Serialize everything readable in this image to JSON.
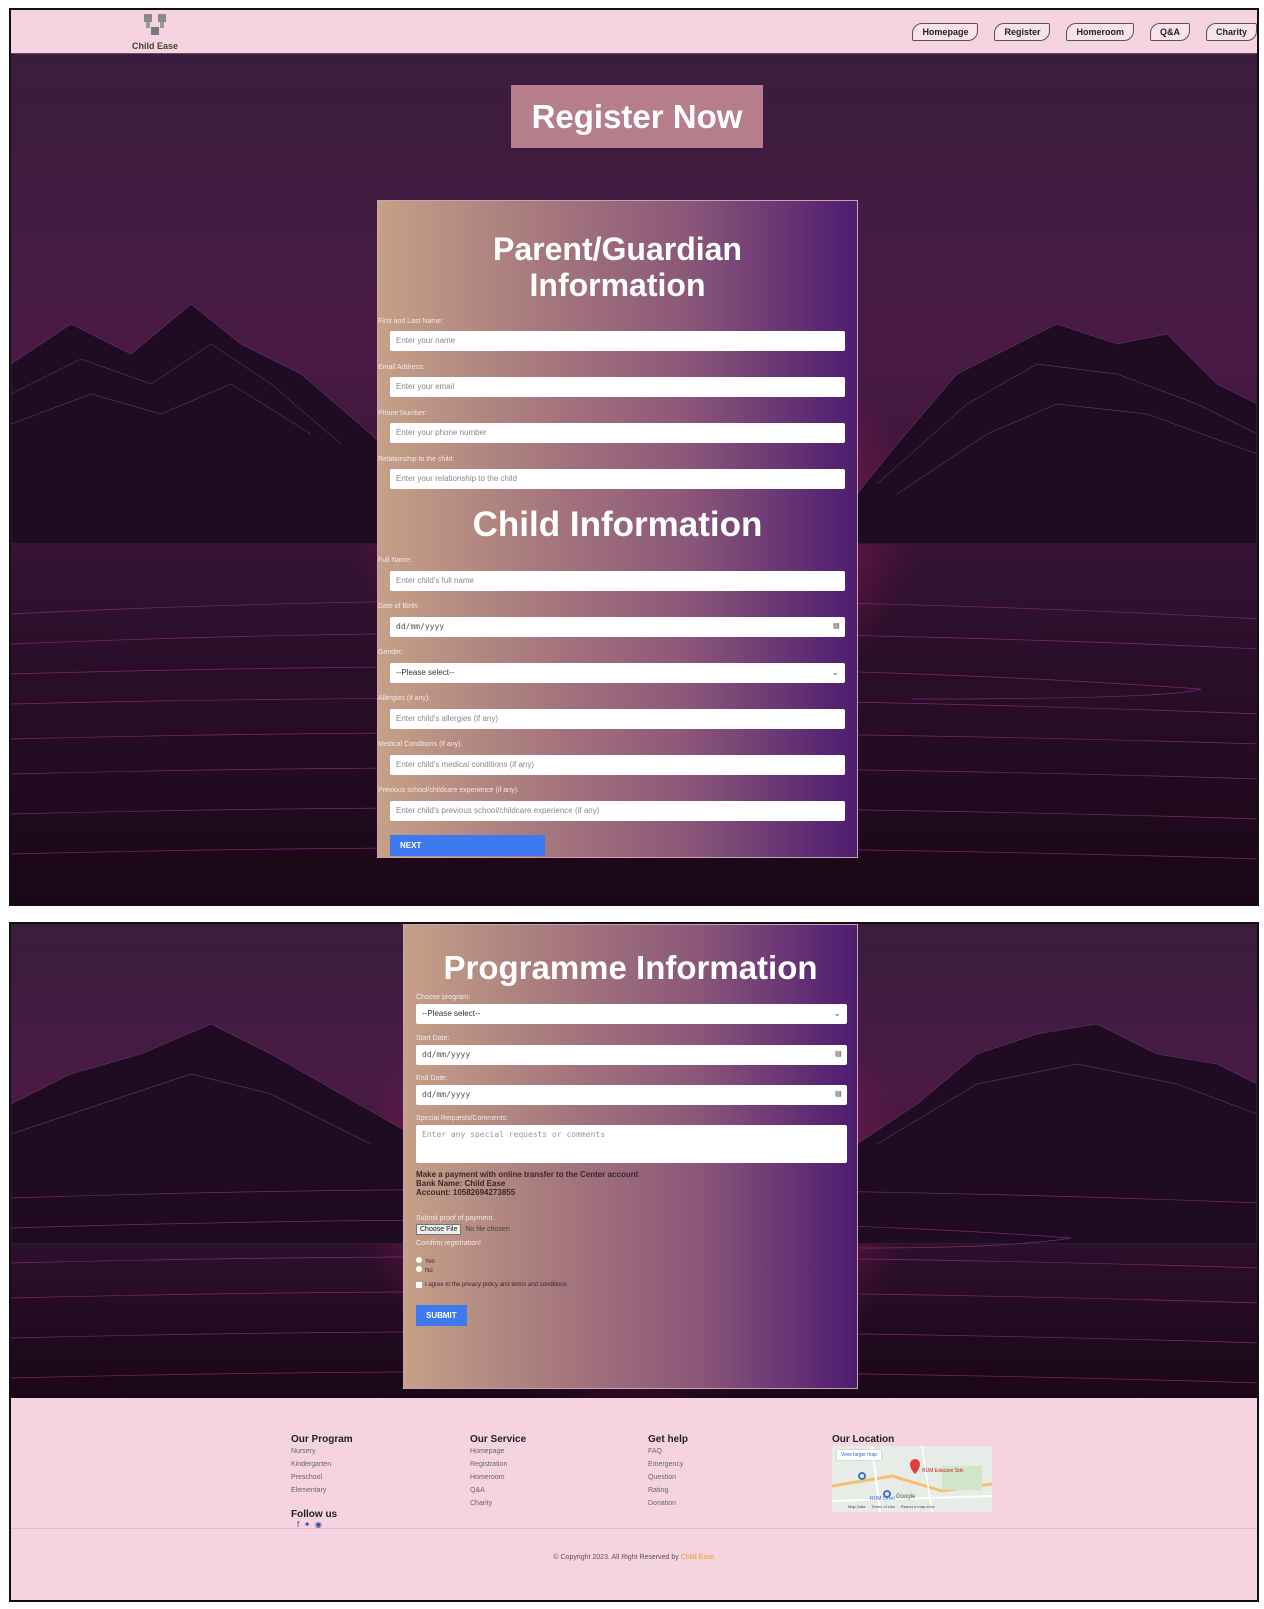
{
  "brand": {
    "name": "Child Ease"
  },
  "nav": {
    "items": [
      "Homepage",
      "Register",
      "Homeroom",
      "Q&A",
      "Charity"
    ]
  },
  "page_title": "Register Now",
  "parent_section": {
    "heading_line1": "Parent/Guardian",
    "heading_line2": "Information",
    "fields": [
      {
        "label": "First and Last Name:",
        "placeholder": "Enter your name"
      },
      {
        "label": "Email Address:",
        "placeholder": "Enter your email"
      },
      {
        "label": "Phone Number:",
        "placeholder": "Enter your phone number"
      },
      {
        "label": "Relationship to the child:",
        "placeholder": "Enter your relationship to the child"
      }
    ]
  },
  "child_section": {
    "heading": "Child Information",
    "full_name": {
      "label": "Full Name:",
      "placeholder": "Enter child's full name"
    },
    "dob": {
      "label": "Date of Birth:",
      "value": "dd/mm/yyyy"
    },
    "gender": {
      "label": "Gender:",
      "selected": "--Please select--"
    },
    "allergies": {
      "label": "Allergies (if any):",
      "placeholder": "Enter child's allergies (if any)"
    },
    "medical": {
      "label": "Medical Conditions (if any):",
      "placeholder": "Enter child's medical conditions (if any)"
    },
    "previous": {
      "label": "Previous school/childcare experience (if any):",
      "placeholder": "Enter child's previous school/childcare experience (if any)"
    },
    "next_button": "NEXT"
  },
  "programme_section": {
    "heading": "Programme Information",
    "program": {
      "label": "Choose program:",
      "selected": "--Please select--"
    },
    "start_date": {
      "label": "Start Date:",
      "value": "dd/mm/yyyy"
    },
    "end_date": {
      "label": "End Date:",
      "value": "dd/mm/yyyy"
    },
    "requests": {
      "label": "Special Requests/Comments:",
      "placeholder": "Enter any special requests or comments"
    },
    "payment_line1": "Make a payment with online transfer to the Center account",
    "payment_bank": "Bank Name: Child Ease",
    "payment_account": "Account: 10582694273855",
    "proof_label": "Submit proof of payment",
    "choose_file": "Choose File",
    "no_file": "No file chosen",
    "confirm_label": "Comfirm registration!",
    "yes": "Yes",
    "no": "No",
    "agree": "I agree to the privacy policy and terms and conditions",
    "submit_button": "SUBMIT"
  },
  "footer": {
    "program": {
      "title": "Our Program",
      "items": [
        "Nursery",
        "Kindergarten",
        "Preschool",
        "Elementary"
      ]
    },
    "service": {
      "title": "Our Service",
      "items": [
        "Homepage",
        "Registration",
        "Homeroom",
        "Q&A",
        "Charity"
      ]
    },
    "help": {
      "title": "Get help",
      "items": [
        "FAQ",
        "Emergency",
        "Question",
        "Rating",
        "Donation"
      ]
    },
    "location": {
      "title": "Our Location",
      "view_larger": "View larger map",
      "place": "RUM Educare Sdn",
      "place2": "RUM Level",
      "google": "Google",
      "map_data": "Map Data",
      "terms": "Terms of Use",
      "report": "Report a map error"
    },
    "follow": "Follow us",
    "copyright_prefix": "© Copyright 2023. All Right Reserved by ",
    "copyright_brand": "Child Ease"
  },
  "colors": {
    "accent_button": "#3d7af0",
    "navbar_bg": "#f6d3e0",
    "title_bg": "#b67e8d",
    "brand_orange": "#f0a020"
  }
}
